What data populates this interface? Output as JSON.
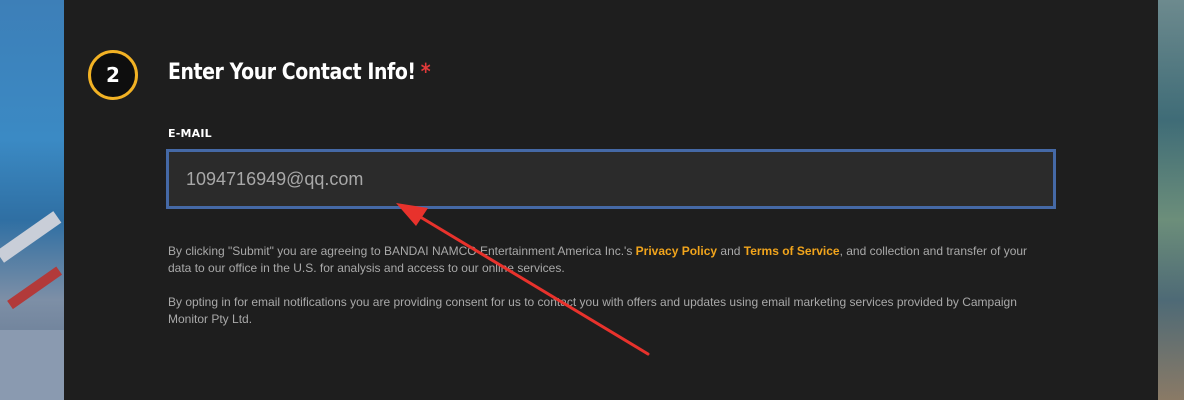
{
  "step": {
    "number": "2",
    "title": "Enter Your Contact Info!",
    "required_mark": "*"
  },
  "email": {
    "label": "E-MAIL",
    "value": "1094716949@qq.com"
  },
  "legal": {
    "p1_before": "By clicking \"Submit\" you are agreeing to BANDAI NAMCO Entertainment America Inc.'s ",
    "privacy_link": "Privacy Policy",
    "p1_and": " and ",
    "terms_link": "Terms of Service",
    "p1_after": ", and collection and transfer of your data to our office in the U.S. for analysis and access to our online services.",
    "p2": "By opting in for email notifications you are providing consent for us to contact you with offers and updates using email marketing services provided by Campaign Monitor Pty Ltd."
  },
  "colors": {
    "accent": "#f2b224",
    "link": "#f2a51c",
    "input_border": "#4569a6",
    "required": "#e23a3a",
    "annotation_arrow": "#e8322c"
  }
}
